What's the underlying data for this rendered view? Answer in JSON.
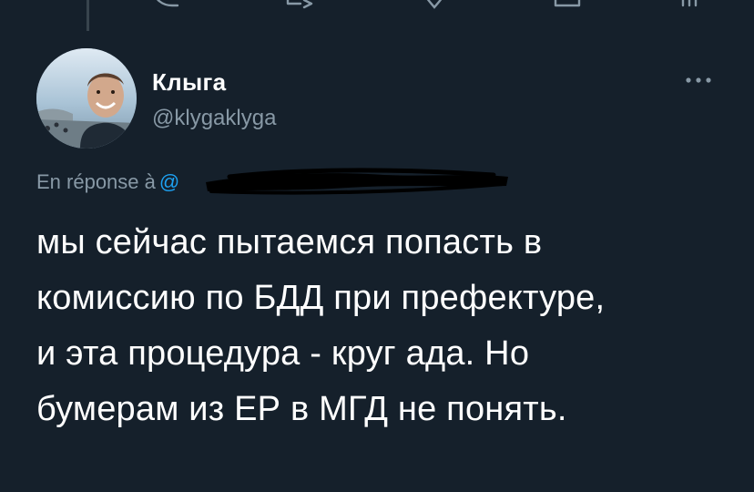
{
  "colors": {
    "background": "#15202b",
    "primary_text": "#ffffff",
    "secondary_text": "#8899a6",
    "accent": "#1da1f2",
    "divider": "#38444d"
  },
  "previous_tweet_actions": {
    "icons": [
      "reply-icon",
      "retweet-icon",
      "like-icon",
      "share-icon",
      "analytics-icon"
    ]
  },
  "tweet": {
    "author": {
      "display_name": "Клыга",
      "handle": "@klygaklyga"
    },
    "more_icon": "more-icon",
    "reply_context": {
      "prefix": "En réponse à",
      "mention": "@"
    },
    "text": "мы сейчас пытаемся попасть в\nкомиссию по БДД при префектуре,\nи эта процедура - круг ада. Но\nбумерам из ЕР в МГД не понять."
  }
}
